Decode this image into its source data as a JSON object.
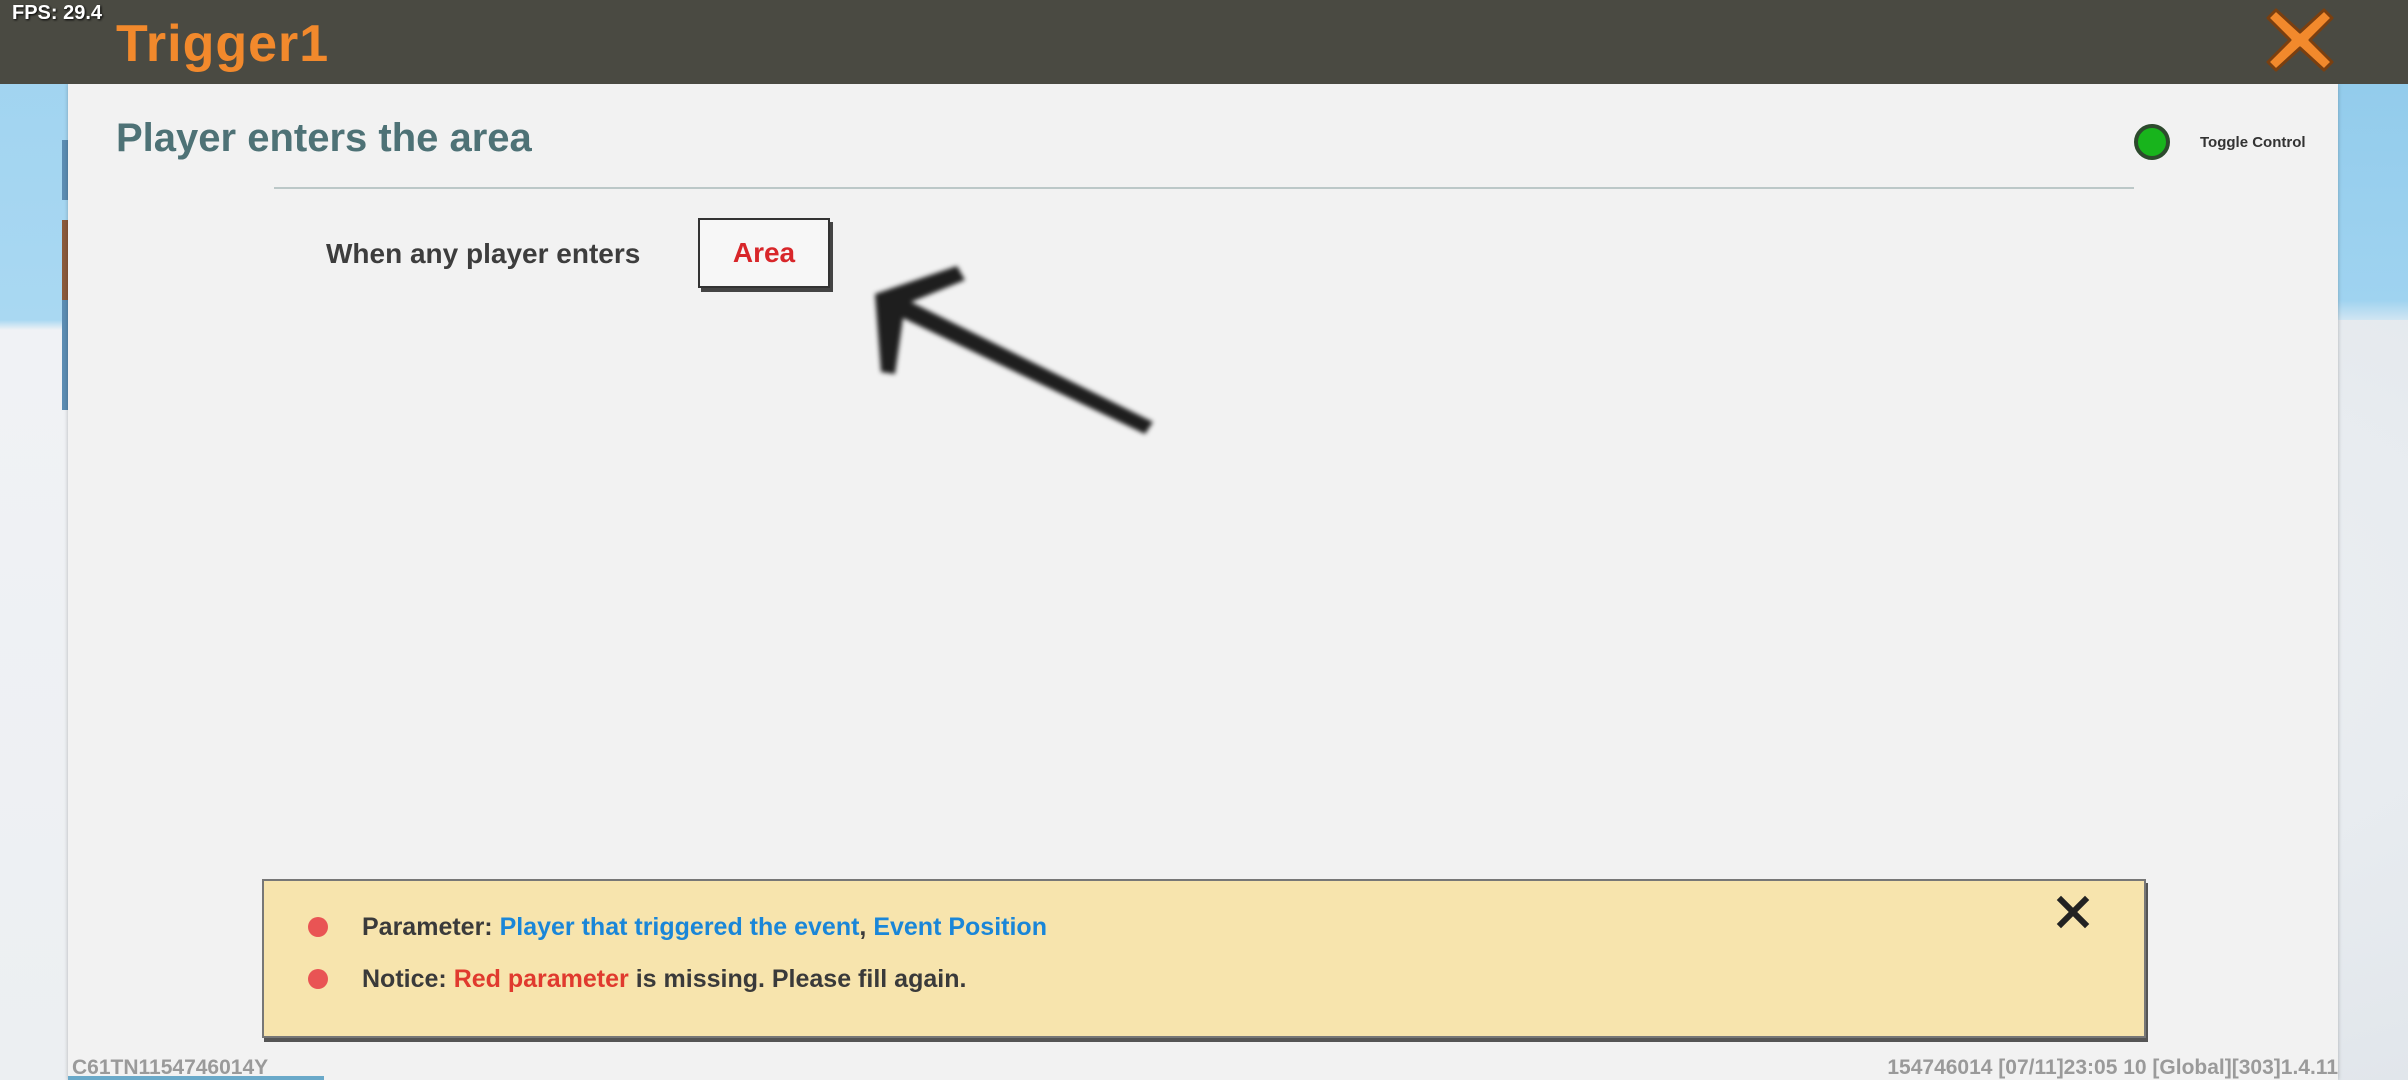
{
  "hud": {
    "fps": "FPS: 29.4"
  },
  "header": {
    "title": "Trigger1",
    "close_icon": "close-x-icon",
    "accent_color": "#f2892c"
  },
  "panel": {
    "title": "Player enters the area",
    "toggle_label": "Toggle Control",
    "toggle_color": "#18b41c"
  },
  "condition": {
    "label": "When any player enters",
    "area_button_label": "Area",
    "pointer_icon": "arrow-pointer-icon"
  },
  "notice": {
    "param_prefix": "Parameter:",
    "param_1": "Player that triggered the event",
    "param_sep": ",",
    "param_2": "Event Position",
    "notice_prefix": "Notice:",
    "notice_red": "Red parameter",
    "notice_rest": "is missing. Please fill again."
  },
  "footer": {
    "left_id": "C61TN1154746014Y",
    "right_info": "154746014    [07/11]23:05 10  [Global][303]1.4.11"
  }
}
